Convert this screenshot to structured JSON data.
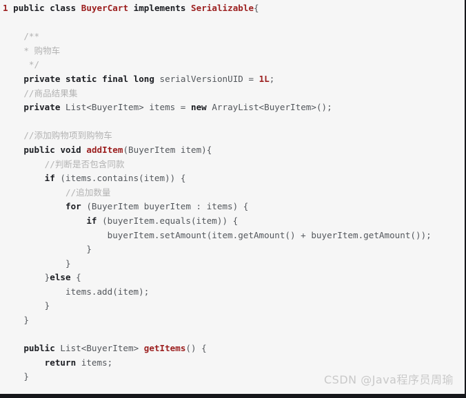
{
  "viewer": {
    "language": "java",
    "background_color": "#f6f6f6",
    "border_color": "#16171b",
    "first_line_number": "1"
  },
  "theme": {
    "keyword_color": "#1b1d22",
    "type_color": "#9c2020",
    "function_color": "#9c2020",
    "number_color": "#9c2020",
    "comment_color": "#b3b3b3",
    "plain_color": "#53575c",
    "line_number_color": "#9c2020",
    "watermark_color": "#c9c9c9"
  },
  "watermark": {
    "text": "CSDN @Java程序员周瑜"
  },
  "code": {
    "lines": [
      {
        "line_number": "1",
        "tokens": [
          {
            "kind": "kw",
            "text": "public"
          },
          {
            "kind": "plain",
            "text": " "
          },
          {
            "kind": "kw",
            "text": "class"
          },
          {
            "kind": "plain",
            "text": " "
          },
          {
            "kind": "type",
            "text": "BuyerCart"
          },
          {
            "kind": "plain",
            "text": " "
          },
          {
            "kind": "kw",
            "text": "implements"
          },
          {
            "kind": "plain",
            "text": " "
          },
          {
            "kind": "type",
            "text": "Serializable"
          },
          {
            "kind": "punc",
            "text": "{"
          }
        ]
      },
      {
        "line_number": "",
        "tokens": []
      },
      {
        "line_number": "",
        "tokens": [
          {
            "kind": "doc",
            "text": "    /**"
          }
        ]
      },
      {
        "line_number": "",
        "tokens": [
          {
            "kind": "doc",
            "text": "    * 购物车"
          }
        ]
      },
      {
        "line_number": "",
        "tokens": [
          {
            "kind": "doc",
            "text": "     */"
          }
        ]
      },
      {
        "line_number": "",
        "tokens": [
          {
            "kind": "plain",
            "text": "    "
          },
          {
            "kind": "kw",
            "text": "private"
          },
          {
            "kind": "plain",
            "text": " "
          },
          {
            "kind": "kw",
            "text": "static"
          },
          {
            "kind": "plain",
            "text": " "
          },
          {
            "kind": "kw",
            "text": "final"
          },
          {
            "kind": "plain",
            "text": " "
          },
          {
            "kind": "kw",
            "text": "long"
          },
          {
            "kind": "plain",
            "text": " serialVersionUID = "
          },
          {
            "kind": "num",
            "text": "1L"
          },
          {
            "kind": "punc",
            "text": ";"
          }
        ]
      },
      {
        "line_number": "",
        "tokens": [
          {
            "kind": "cmt",
            "text": "    //商品结果集"
          }
        ]
      },
      {
        "line_number": "",
        "tokens": [
          {
            "kind": "plain",
            "text": "    "
          },
          {
            "kind": "kw",
            "text": "private"
          },
          {
            "kind": "plain",
            "text": " List<BuyerItem> items = "
          },
          {
            "kind": "kw",
            "text": "new"
          },
          {
            "kind": "plain",
            "text": " ArrayList<BuyerItem>();"
          }
        ]
      },
      {
        "line_number": "",
        "tokens": []
      },
      {
        "line_number": "",
        "tokens": [
          {
            "kind": "cmt",
            "text": "    //添加购物项到购物车"
          }
        ]
      },
      {
        "line_number": "",
        "tokens": [
          {
            "kind": "plain",
            "text": "    "
          },
          {
            "kind": "kw",
            "text": "public"
          },
          {
            "kind": "plain",
            "text": " "
          },
          {
            "kind": "kw",
            "text": "void"
          },
          {
            "kind": "plain",
            "text": " "
          },
          {
            "kind": "fn",
            "text": "addItem"
          },
          {
            "kind": "plain",
            "text": "(BuyerItem item){"
          }
        ]
      },
      {
        "line_number": "",
        "tokens": [
          {
            "kind": "cmt",
            "text": "        //判断是否包含同款"
          }
        ]
      },
      {
        "line_number": "",
        "tokens": [
          {
            "kind": "plain",
            "text": "        "
          },
          {
            "kind": "kw",
            "text": "if"
          },
          {
            "kind": "plain",
            "text": " (items.contains(item)) {"
          }
        ]
      },
      {
        "line_number": "",
        "tokens": [
          {
            "kind": "cmt",
            "text": "            //追加数量"
          }
        ]
      },
      {
        "line_number": "",
        "tokens": [
          {
            "kind": "plain",
            "text": "            "
          },
          {
            "kind": "kw",
            "text": "for"
          },
          {
            "kind": "plain",
            "text": " (BuyerItem buyerItem : items) {"
          }
        ]
      },
      {
        "line_number": "",
        "tokens": [
          {
            "kind": "plain",
            "text": "                "
          },
          {
            "kind": "kw",
            "text": "if"
          },
          {
            "kind": "plain",
            "text": " (buyerItem.equals(item)) {"
          }
        ]
      },
      {
        "line_number": "",
        "tokens": [
          {
            "kind": "plain",
            "text": "                    buyerItem.setAmount(item.getAmount() + buyerItem.getAmount());"
          }
        ]
      },
      {
        "line_number": "",
        "tokens": [
          {
            "kind": "plain",
            "text": "                }"
          }
        ]
      },
      {
        "line_number": "",
        "tokens": [
          {
            "kind": "plain",
            "text": "            }"
          }
        ]
      },
      {
        "line_number": "",
        "tokens": [
          {
            "kind": "plain",
            "text": "        }"
          },
          {
            "kind": "kw",
            "text": "else"
          },
          {
            "kind": "plain",
            "text": " {"
          }
        ]
      },
      {
        "line_number": "",
        "tokens": [
          {
            "kind": "plain",
            "text": "            items.add(item);"
          }
        ]
      },
      {
        "line_number": "",
        "tokens": [
          {
            "kind": "plain",
            "text": "        }"
          }
        ]
      },
      {
        "line_number": "",
        "tokens": [
          {
            "kind": "plain",
            "text": "    }"
          }
        ]
      },
      {
        "line_number": "",
        "tokens": []
      },
      {
        "line_number": "",
        "tokens": [
          {
            "kind": "plain",
            "text": "    "
          },
          {
            "kind": "kw",
            "text": "public"
          },
          {
            "kind": "plain",
            "text": " List<BuyerItem> "
          },
          {
            "kind": "fn",
            "text": "getItems"
          },
          {
            "kind": "plain",
            "text": "() {"
          }
        ]
      },
      {
        "line_number": "",
        "tokens": [
          {
            "kind": "plain",
            "text": "        "
          },
          {
            "kind": "kw",
            "text": "return"
          },
          {
            "kind": "plain",
            "text": " items;"
          }
        ]
      },
      {
        "line_number": "",
        "tokens": [
          {
            "kind": "plain",
            "text": "    }"
          }
        ]
      }
    ]
  }
}
